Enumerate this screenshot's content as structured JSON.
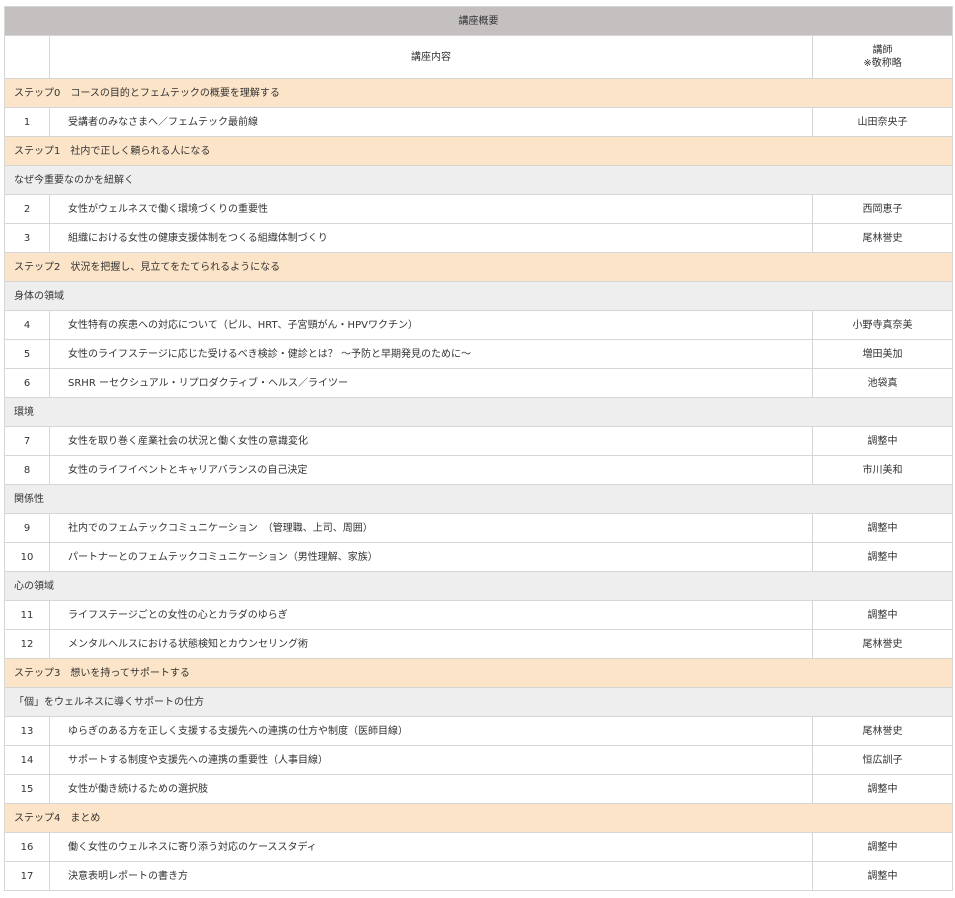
{
  "table": {
    "title": "講座概要",
    "header": {
      "no": "",
      "content": "講座内容",
      "teacher_line1": "講師",
      "teacher_line2": "※敬称略"
    },
    "rows": [
      {
        "type": "step",
        "text": "ステップ0　コースの目的とフェムテックの概要を理解する"
      },
      {
        "type": "item",
        "no": "1",
        "content": "受講者のみなさまへ／フェムテック最前線",
        "teacher": "山田奈央子"
      },
      {
        "type": "step",
        "text": "ステップ1　社内で正しく頼られる人になる"
      },
      {
        "type": "category",
        "text": "なぜ今重要なのかを紐解く"
      },
      {
        "type": "item",
        "no": "2",
        "content": "女性がウェルネスで働く環境づくりの重要性",
        "teacher": "西岡恵子"
      },
      {
        "type": "item",
        "no": "3",
        "content": "組織における女性の健康支援体制をつくる組織体制づくり",
        "teacher": "尾林誉史"
      },
      {
        "type": "step",
        "text": "ステップ2　状況を把握し、見立てをたてられるようになる"
      },
      {
        "type": "category",
        "text": "身体の領域"
      },
      {
        "type": "item",
        "no": "4",
        "content": "女性特有の疾患への対応について（ピル、HRT、子宮頸がん・HPVワクチン）",
        "teacher": "小野寺真奈美"
      },
      {
        "type": "item",
        "no": "5",
        "content": "女性のライフステージに応じた受けるべき検診・健診とは？ ～予防と早期発見のために～",
        "teacher": "増田美加"
      },
      {
        "type": "item",
        "no": "6",
        "content": "SRHR ーセクシュアル・リプロダクティブ・ヘルス／ライツー",
        "teacher": "池袋真"
      },
      {
        "type": "category",
        "text": "環境"
      },
      {
        "type": "item",
        "no": "7",
        "content": "女性を取り巻く産業社会の状況と働く女性の意識変化",
        "teacher": "調整中"
      },
      {
        "type": "item",
        "no": "8",
        "content": "女性のライフイベントとキャリアバランスの自己決定",
        "teacher": "市川美和"
      },
      {
        "type": "category",
        "text": "関係性"
      },
      {
        "type": "item",
        "no": "9",
        "content": "社内でのフェムテックコミュニケーション　（管理職、上司、周囲）",
        "teacher": "調整中"
      },
      {
        "type": "item",
        "no": "10",
        "content": "パートナーとのフェムテックコミュニケーション（男性理解、家族）",
        "teacher": "調整中"
      },
      {
        "type": "category",
        "text": "心の領域"
      },
      {
        "type": "item",
        "no": "11",
        "content": "ライフステージごとの女性の心とカラダのゆらぎ",
        "teacher": "調整中"
      },
      {
        "type": "item",
        "no": "12",
        "content": "メンタルヘルスにおける状態検知とカウンセリング術",
        "teacher": "尾林誉史"
      },
      {
        "type": "step",
        "text": "ステップ3　想いを持ってサポートする"
      },
      {
        "type": "category",
        "text": "「個」をウェルネスに導くサポートの仕方"
      },
      {
        "type": "item",
        "no": "13",
        "content": "ゆらぎのある方を正しく支援する支援先への連携の仕方や制度（医師目線）",
        "teacher": "尾林誉史"
      },
      {
        "type": "item",
        "no": "14",
        "content": "サポートする制度や支援先への連携の重要性（人事目線）",
        "teacher": "恒広訓子"
      },
      {
        "type": "item",
        "no": "15",
        "content": "女性が働き続けるための選択肢",
        "teacher": "調整中"
      },
      {
        "type": "step",
        "text": "ステップ4　まとめ"
      },
      {
        "type": "item",
        "no": "16",
        "content": "働く女性のウェルネスに寄り添う対応のケーススタディ",
        "teacher": "調整中"
      },
      {
        "type": "item",
        "no": "17",
        "content": "決意表明レポートの書き方",
        "teacher": "調整中"
      }
    ]
  },
  "colors": {
    "title_bg": "#c4c0c0",
    "step_bg": "#fce4c8",
    "category_bg": "#eeeeee",
    "border": "#d6d6d6",
    "text": "#333333"
  }
}
